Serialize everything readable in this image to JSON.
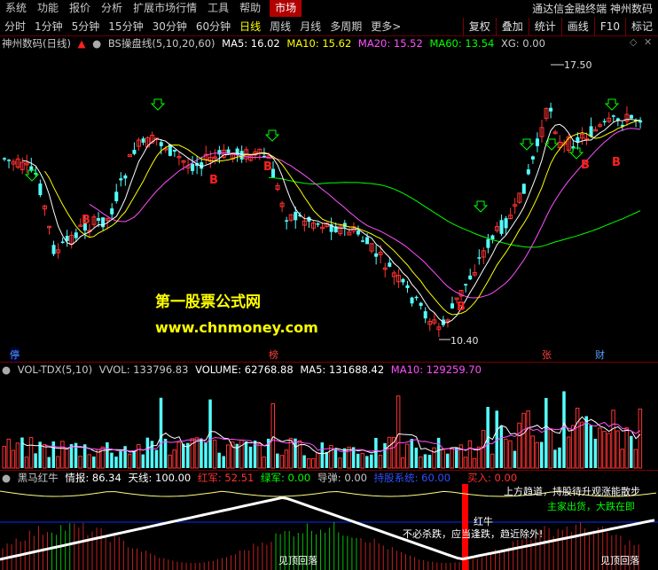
{
  "menu": {
    "items": [
      "系统",
      "功能",
      "报价",
      "分析",
      "扩展市场行情",
      "工具",
      "帮助"
    ],
    "active": "市场",
    "right_title": "通达信金融终端 神州数码"
  },
  "periods": {
    "items": [
      "分时",
      "1分钟",
      "5分钟",
      "15分钟",
      "30分钟",
      "60分钟",
      "日线",
      "周线",
      "月线",
      "多周期",
      "更多>"
    ],
    "selected": "日线",
    "tools": [
      "复权",
      "叠加",
      "统计",
      "画线",
      "F10",
      "标记"
    ]
  },
  "main_header": {
    "stock": "神州数码(日线)",
    "indicator": "BS操盘线(5,10,20,60)",
    "ma5": "MA5: 16.02",
    "ma10": "MA10: 15.62",
    "ma20": "MA20: 15.52",
    "ma60": "MA60: 13.54",
    "xg": "XG: 0.00"
  },
  "annotations": {
    "high": "17.50",
    "low": "10.40",
    "watermark_cn": "第一股票公式网",
    "watermark_url": "www.chnmoney.com",
    "bottom_tags": [
      "停",
      "榜",
      "张",
      "财"
    ]
  },
  "vol_header": {
    "name": "VOL-TDX(5,10)",
    "vvol": "VVOL: 133796.83",
    "volume": "VOLUME: 62768.88",
    "ma5": "MA5: 131688.42",
    "ma10": "MA10: 129259.70"
  },
  "ind_header": {
    "name": "黑马红牛",
    "qingbao": "情报: 86.34",
    "tianxian": "天线: 100.00",
    "hongjun": "红军: 52.51",
    "lvjun": "绿军: 0.00",
    "daotan": "导弹: 0.00",
    "chiyou": "持股系统: 60.00"
  },
  "ind_texts": {
    "buy": "买入: 0.00",
    "t1": "上方趋道，持股待升观涨能散步",
    "t2": "主家出货，大跌在即",
    "t3": "红牛",
    "t4": "不必杀跌，应当逢跌，趋近除外!",
    "t5": "见顶回落",
    "t6": "见顶回落"
  },
  "colors": {
    "up": "#ff3232",
    "down": "#54ffff",
    "ma5": "#ffffff",
    "ma10": "#ffff00",
    "ma20": "#ff50ff",
    "ma60": "#00ff00",
    "accent": "#b00000"
  }
}
